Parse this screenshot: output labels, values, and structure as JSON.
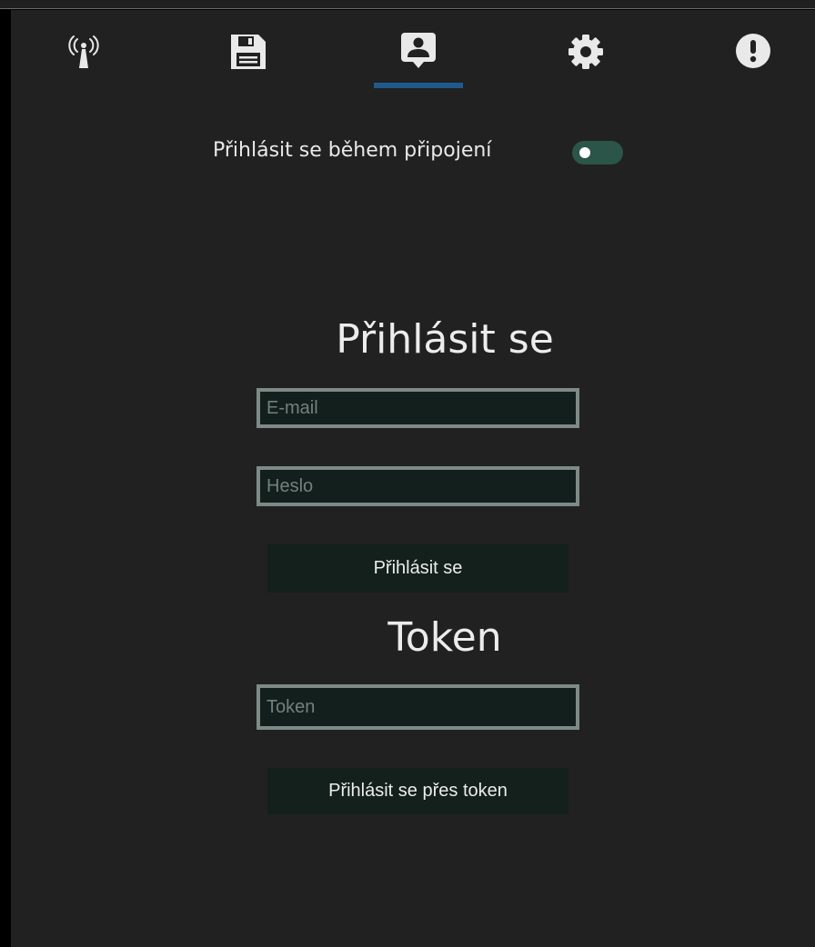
{
  "tabs": [
    {
      "icon": "wireless-tower-icon"
    },
    {
      "icon": "floppy-disk-icon"
    },
    {
      "icon": "account-box-icon",
      "active": true
    },
    {
      "icon": "gear-icon"
    },
    {
      "icon": "alert-circle-icon"
    }
  ],
  "toggle": {
    "label": "Přihlásit se během připojení",
    "enabled": true
  },
  "login": {
    "heading": "Přihlásit se",
    "email_placeholder": "E-mail",
    "password_placeholder": "Heslo",
    "submit_label": "Přihlásit se"
  },
  "token": {
    "heading": "Token",
    "token_placeholder": "Token",
    "submit_label": "Přihlásit se přes token"
  },
  "colors": {
    "background": "#212121",
    "accent_indicator": "#1e5a8c",
    "toggle_track": "#2b5548",
    "input_background": "#131f1c",
    "input_border": "#7d8a86",
    "button_background": "#13201c"
  }
}
